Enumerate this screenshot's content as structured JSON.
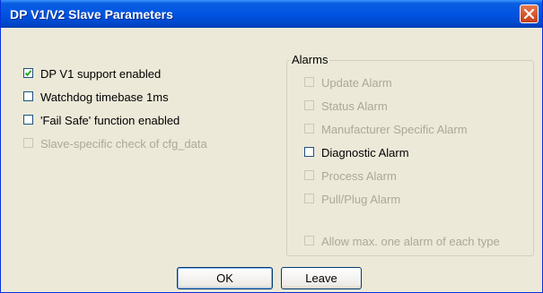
{
  "window": {
    "title": "DP V1/V2 Slave Parameters",
    "close_icon": "close-icon"
  },
  "left_options": [
    {
      "label": "DP V1 support enabled",
      "checked": true,
      "enabled": true
    },
    {
      "label": "Watchdog timebase 1ms",
      "checked": false,
      "enabled": true
    },
    {
      "label": "'Fail Safe' function enabled",
      "checked": false,
      "enabled": true
    },
    {
      "label": "Slave-specific check of cfg_data",
      "checked": false,
      "enabled": false
    }
  ],
  "alarms": {
    "label": "Alarms",
    "items": [
      {
        "label": "Update Alarm",
        "checked": false,
        "enabled": false
      },
      {
        "label": "Status Alarm",
        "checked": false,
        "enabled": false
      },
      {
        "label": "Manufacturer Specific Alarm",
        "checked": false,
        "enabled": false
      },
      {
        "label": "Diagnostic Alarm",
        "checked": false,
        "enabled": true
      },
      {
        "label": "Process Alarm",
        "checked": false,
        "enabled": false
      },
      {
        "label": "Pull/Plug Alarm",
        "checked": false,
        "enabled": false
      }
    ],
    "one_of_each": {
      "label": "Allow max. one alarm of each type",
      "checked": false,
      "enabled": false
    }
  },
  "buttons": {
    "ok": "OK",
    "leave": "Leave"
  }
}
